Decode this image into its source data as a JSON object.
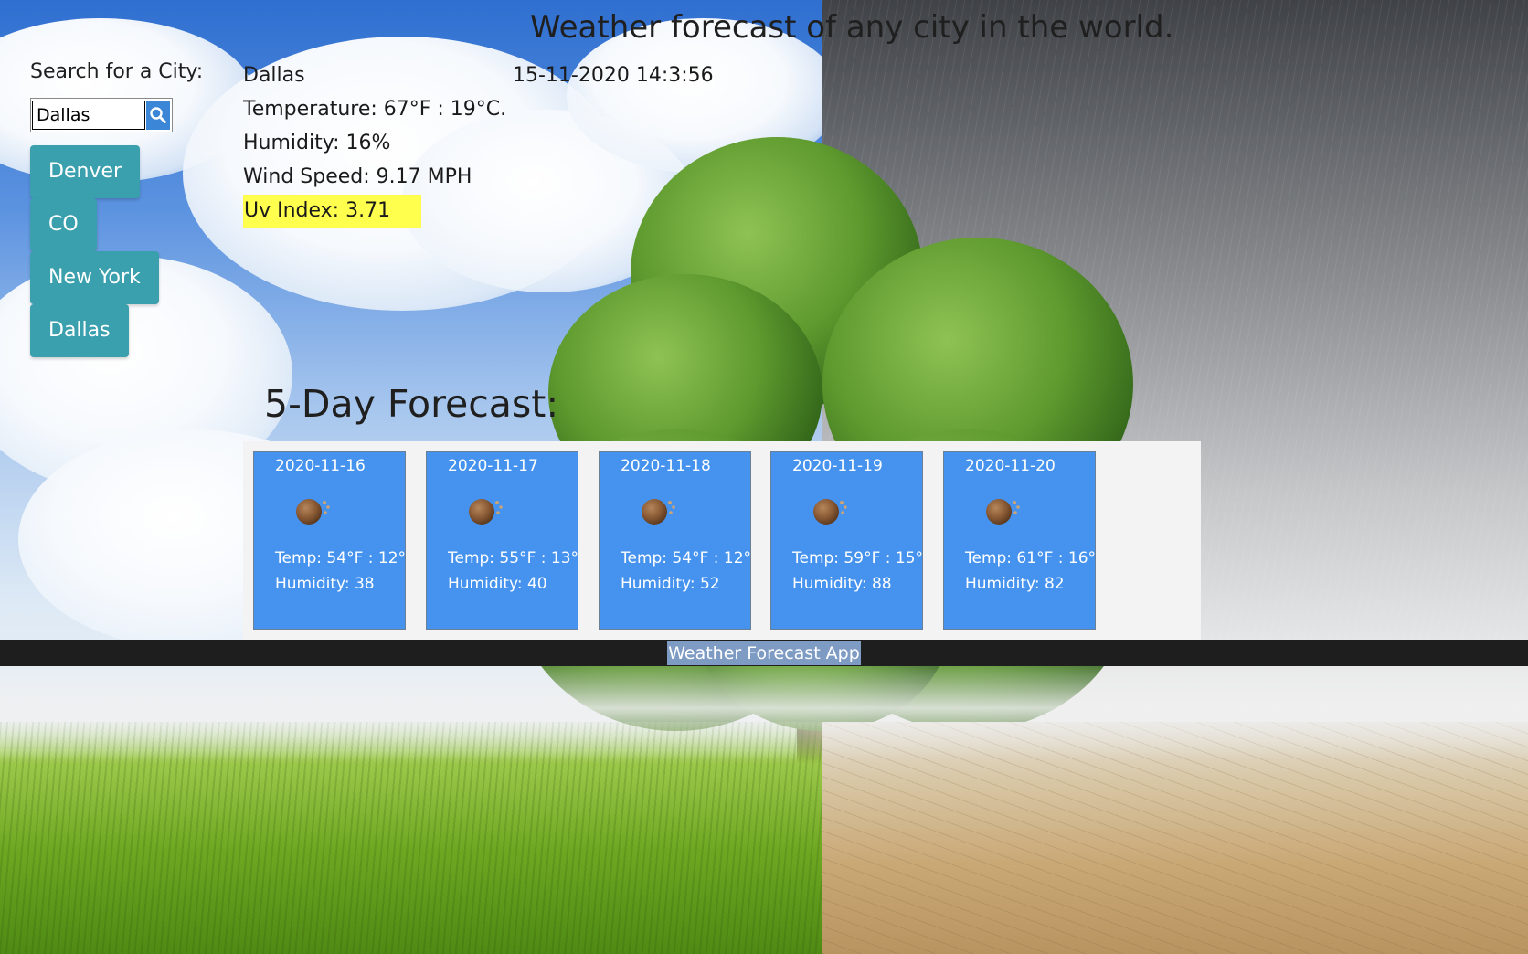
{
  "page": {
    "title": "Weather forecast of any city in the world."
  },
  "search": {
    "label": "Search for a City:",
    "value": "Dallas",
    "button_icon": "search-icon"
  },
  "cities": [
    {
      "label": "Denver"
    },
    {
      "label": "CO"
    },
    {
      "label": "New York"
    },
    {
      "label": "Dallas"
    }
  ],
  "current": {
    "city": "Dallas",
    "datetime": "15-11-2020 14:3:56",
    "temperature": "Temperature: 67°F : 19°C.",
    "humidity": "Humidity: 16%",
    "wind": "Wind Speed: 9.17 MPH",
    "uv": "Uv Index: 3.71",
    "uv_color": "#ffff4d"
  },
  "forecast": {
    "title": "5-Day Forecast:",
    "card_color": "#4593ee",
    "days": [
      {
        "date": "2020-11-16",
        "icon": "weather-icon",
        "temp": "Temp: 54°F : 12°",
        "humidity": "Humidity: 38"
      },
      {
        "date": "2020-11-17",
        "icon": "weather-icon",
        "temp": "Temp: 55°F : 13°",
        "humidity": "Humidity: 40"
      },
      {
        "date": "2020-11-18",
        "icon": "weather-icon",
        "temp": "Temp: 54°F : 12°",
        "humidity": "Humidity: 52"
      },
      {
        "date": "2020-11-19",
        "icon": "weather-icon",
        "temp": "Temp: 59°F : 15°",
        "humidity": "Humidity: 88"
      },
      {
        "date": "2020-11-20",
        "icon": "weather-icon",
        "temp": "Temp: 61°F : 16°",
        "humidity": "Humidity: 82"
      }
    ]
  },
  "footer": {
    "text": "Weather Forecast App"
  },
  "colors": {
    "city_button": "#3ba0ae",
    "footer_bg": "#1e1e1e"
  }
}
